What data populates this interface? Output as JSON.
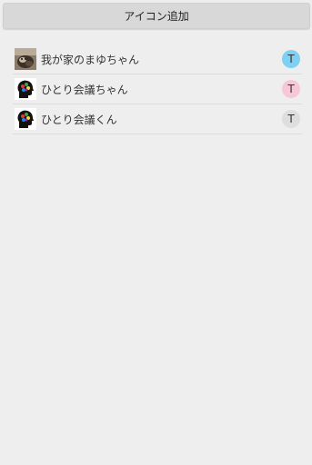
{
  "header": {
    "add_icon_label": "アイコン追加"
  },
  "rows": [
    {
      "name": "我が家のまゆちゃん",
      "icon": "cat-photo-icon",
      "badge": {
        "letter": "T",
        "color": "#7fd0f2"
      }
    },
    {
      "name": "ひとり会議ちゃん",
      "icon": "brain-head-icon",
      "badge": {
        "letter": "T",
        "color": "#f6c8d6"
      }
    },
    {
      "name": "ひとり会議くん",
      "icon": "brain-head-icon",
      "badge": {
        "letter": "T",
        "color": "#dedede"
      }
    }
  ]
}
